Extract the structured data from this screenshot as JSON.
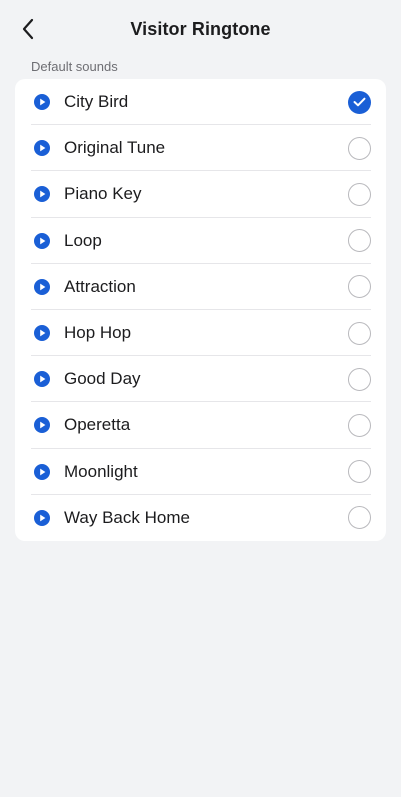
{
  "header": {
    "title": "Visitor Ringtone"
  },
  "section": {
    "label": "Default sounds"
  },
  "colors": {
    "accent": "#1a5fd6",
    "background": "#f2f3f5"
  },
  "icons": {
    "back": "chevron-left-icon",
    "play": "play-circle-icon",
    "selected": "checkmark-circle-icon",
    "unselected": "empty-circle-icon"
  },
  "sounds": [
    {
      "label": "City Bird",
      "selected": true
    },
    {
      "label": "Original Tune",
      "selected": false
    },
    {
      "label": "Piano Key",
      "selected": false
    },
    {
      "label": "Loop",
      "selected": false
    },
    {
      "label": "Attraction",
      "selected": false
    },
    {
      "label": "Hop Hop",
      "selected": false
    },
    {
      "label": "Good Day",
      "selected": false
    },
    {
      "label": "Operetta",
      "selected": false
    },
    {
      "label": "Moonlight",
      "selected": false
    },
    {
      "label": "Way Back Home",
      "selected": false
    }
  ]
}
